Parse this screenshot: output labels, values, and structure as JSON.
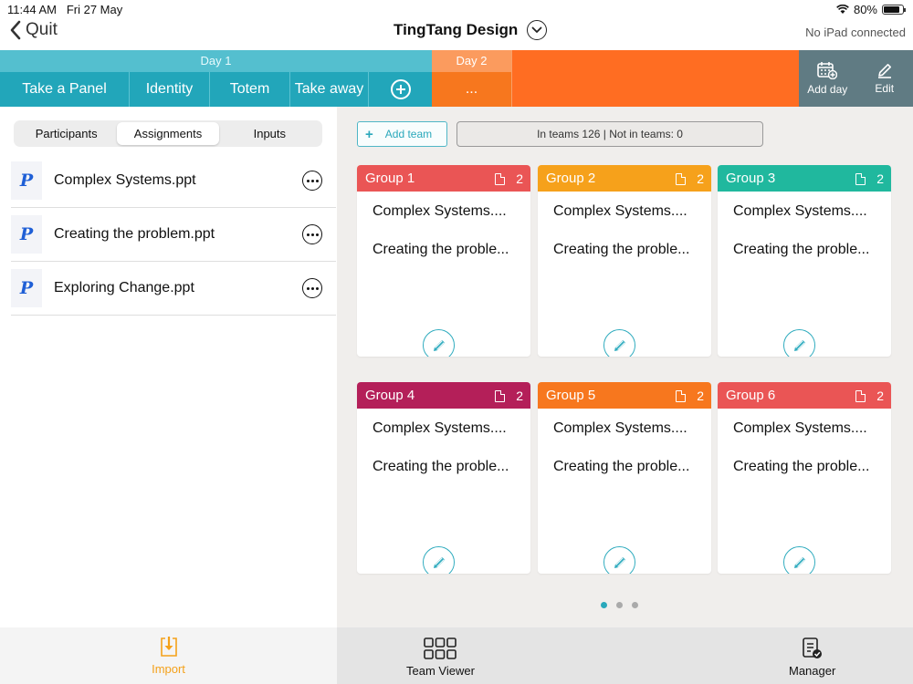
{
  "status": {
    "time": "11:44 AM",
    "date": "Fri 27 May",
    "battery": "80%"
  },
  "nav": {
    "back_label": "Quit",
    "title": "TingTang Design",
    "connection": "No iPad connected"
  },
  "days": [
    {
      "label": "Day 1",
      "tabs": [
        "Take a Panel",
        "Identity",
        "Totem",
        "Take away"
      ]
    },
    {
      "label": "Day 2",
      "tabs": [
        "..."
      ]
    }
  ],
  "actions": {
    "add_day": "Add day",
    "edit": "Edit"
  },
  "segments": [
    "Participants",
    "Assignments",
    "Inputs"
  ],
  "files": [
    "Complex Systems.ppt",
    "Creating the problem.ppt",
    "Exploring Change.ppt"
  ],
  "team_controls": {
    "add_team": "Add team",
    "summary": "In teams 126 | Not in teams: 0"
  },
  "groups": [
    {
      "name": "Group 1",
      "count": "2",
      "color": "#ea5555",
      "items": [
        "Complex Systems....",
        "Creating the proble..."
      ]
    },
    {
      "name": "Group 2",
      "count": "2",
      "color": "#f6a11b",
      "items": [
        "Complex Systems....",
        "Creating the proble..."
      ]
    },
    {
      "name": "Group 3",
      "count": "2",
      "color": "#20b89e",
      "items": [
        "Complex Systems....",
        "Creating the proble..."
      ]
    },
    {
      "name": "Group 4",
      "count": "2",
      "color": "#b41f59",
      "items": [
        "Complex Systems....",
        "Creating the proble..."
      ]
    },
    {
      "name": "Group 5",
      "count": "2",
      "color": "#f7771e",
      "items": [
        "Complex Systems....",
        "Creating the proble..."
      ]
    },
    {
      "name": "Group 6",
      "count": "2",
      "color": "#ea5555",
      "items": [
        "Complex Systems....",
        "Creating the proble..."
      ]
    }
  ],
  "tabbar": {
    "import": "Import",
    "team_viewer": "Team Viewer",
    "manager": "Manager"
  }
}
